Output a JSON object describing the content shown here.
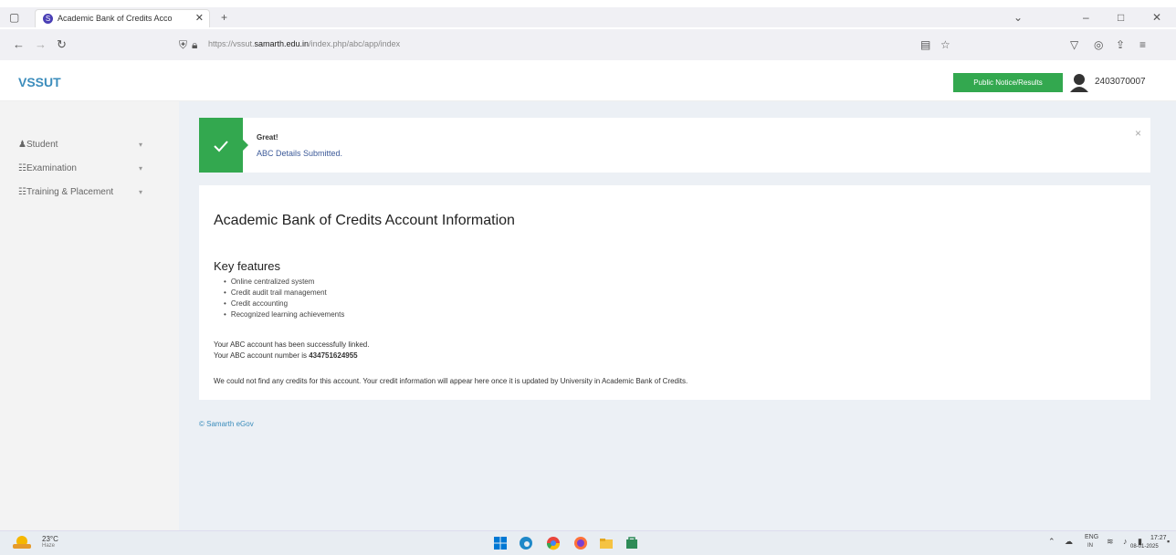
{
  "browser": {
    "tab_title": "Academic Bank of Credits Acco",
    "tab_close": "✕",
    "new_tab": "+",
    "url_prefix": "https://vssut.",
    "url_domain": "samarth.edu.in",
    "url_path": "/index.php/abc/app/index"
  },
  "header": {
    "brand": "VSSUT",
    "notice_button": "Public Notice/Results",
    "user_id": "2403070007"
  },
  "sidebar": {
    "items": [
      {
        "label": "Student",
        "icon": "user-icon"
      },
      {
        "label": "Examination",
        "icon": "exam-icon"
      },
      {
        "label": "Training & Placement",
        "icon": "training-icon"
      }
    ]
  },
  "alert": {
    "title": "Great!",
    "message": "ABC Details Submitted.",
    "close": "×"
  },
  "main": {
    "title": "Academic Bank of Credits Account Information",
    "features_heading": "Key features",
    "features": [
      "Online centralized system",
      "Credit audit trail management",
      "Credit accounting",
      "Recognized learning achievements"
    ],
    "linked_text": "Your ABC account has been successfully linked.",
    "account_prefix": "Your ABC account number is ",
    "account_number": "434751624955",
    "no_credits_text": "We could not find any credits for this account. Your credit information will appear here once it is updated by University in Academic Bank of Credits."
  },
  "footer": {
    "link": "© Samarth eGov"
  },
  "taskbar": {
    "temperature": "23°C",
    "weather": "Haze",
    "lang": "ENG",
    "lang_region": "IN",
    "time": "17:27",
    "date": "08-01-2025"
  },
  "colors": {
    "accent_green": "#33a84f",
    "brand_blue": "#3c8dbc"
  }
}
